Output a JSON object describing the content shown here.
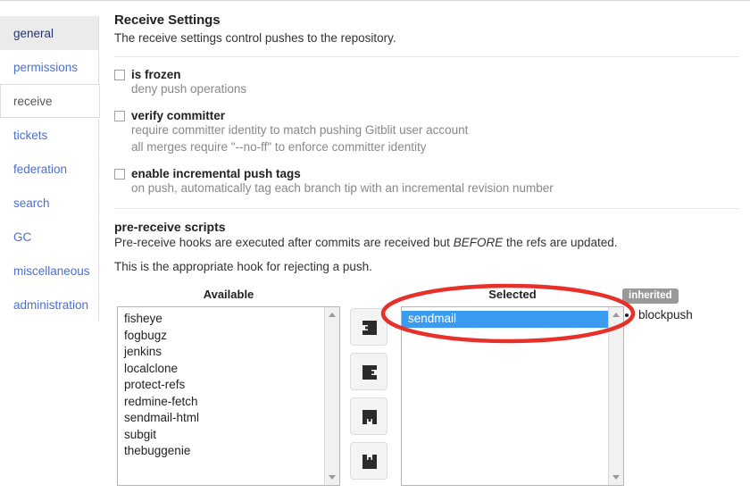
{
  "sidebar": {
    "items": [
      {
        "label": "general",
        "state": "hovered"
      },
      {
        "label": "permissions",
        "state": "link"
      },
      {
        "label": "receive",
        "state": "active"
      },
      {
        "label": "tickets",
        "state": "link"
      },
      {
        "label": "federation",
        "state": "link"
      },
      {
        "label": "search",
        "state": "link"
      },
      {
        "label": "GC",
        "state": "link"
      },
      {
        "label": "miscellaneous",
        "state": "link"
      },
      {
        "label": "administration",
        "state": "link"
      }
    ]
  },
  "header": {
    "title": "Receive Settings",
    "subtitle": "The receive settings control pushes to the repository."
  },
  "settings": [
    {
      "label": "is frozen",
      "checked": false,
      "hints": [
        "deny push operations"
      ]
    },
    {
      "label": "verify committer",
      "checked": false,
      "hints": [
        "require committer identity to match pushing Gitblit user account",
        "all merges require \"--no-ff\" to enforce committer identity"
      ]
    },
    {
      "label": "enable incremental push tags",
      "checked": false,
      "hints": [
        "on push, automatically tag each branch tip with an incremental revision number"
      ]
    }
  ],
  "prereceive": {
    "title": "pre-receive scripts",
    "description_before": "Pre-receive hooks are executed after commits are received but ",
    "description_emphasis": "BEFORE",
    "description_after": " the refs are updated.",
    "note": "This is the appropriate hook for rejecting a push.",
    "available_label": "Available",
    "selected_label": "Selected",
    "available_items": [
      "fisheye",
      "fogbugz",
      "jenkins",
      "localclone",
      "protect-refs",
      "redmine-fetch",
      "sendmail-html",
      "subgit",
      "thebuggenie"
    ],
    "selected_items": [
      {
        "label": "sendmail",
        "selected": true
      }
    ],
    "buttons": [
      {
        "name": "move-right-button",
        "icon": "arrow-right-icon",
        "title": "add"
      },
      {
        "name": "move-left-button",
        "icon": "arrow-left-icon",
        "title": "remove"
      },
      {
        "name": "move-up-button",
        "icon": "arrow-up-icon",
        "title": "move up"
      },
      {
        "name": "move-down-button",
        "icon": "arrow-down-icon",
        "title": "move down"
      }
    ]
  },
  "inherited": {
    "badge": "inherited",
    "items": [
      "blockpush"
    ]
  },
  "annotation": {
    "shape": "ellipse",
    "color": "#e8302a"
  },
  "colors": {
    "link": "#4a6fd4",
    "selection": "#3b9bf1",
    "badge": "#999999",
    "annotation": "#e8302a"
  }
}
